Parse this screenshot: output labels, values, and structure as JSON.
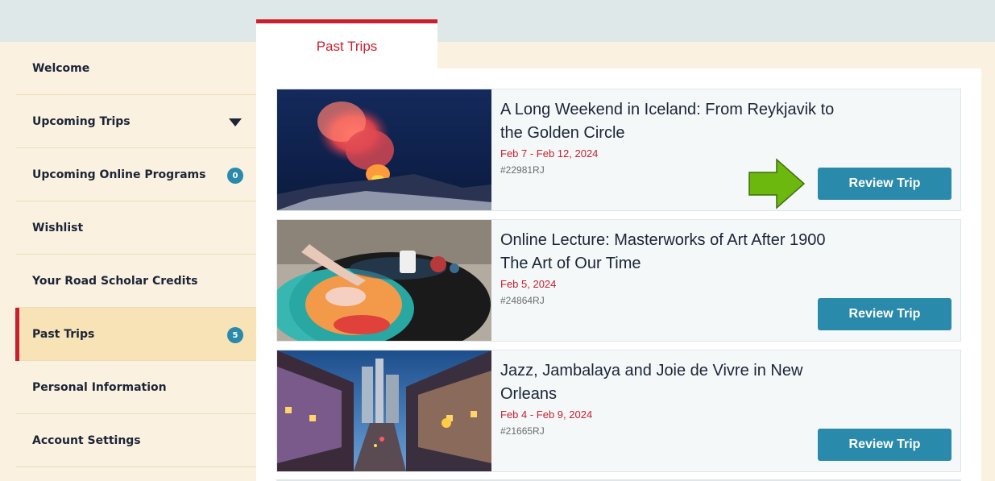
{
  "sidebar": {
    "items": [
      {
        "label": "Welcome"
      },
      {
        "label": "Upcoming Trips"
      },
      {
        "label": "Upcoming Online Programs",
        "badge": "0"
      },
      {
        "label": "Wishlist"
      },
      {
        "label": "Your Road Scholar Credits"
      },
      {
        "label": "Past Trips",
        "badge": "5"
      },
      {
        "label": "Personal Information"
      },
      {
        "label": "Account Settings"
      }
    ]
  },
  "tab": {
    "label": "Past Trips"
  },
  "trips": [
    {
      "title": "A Long Weekend in Iceland: From Reykjavik to the Golden Circle",
      "dates": "Feb 7 - Feb 12, 2024",
      "code": "#22981RJ",
      "button": "Review Trip"
    },
    {
      "title": "Online Lecture: Masterworks of Art After 1900  The Art of Our Time",
      "dates": "Feb 5, 2024",
      "code": "#24864RJ",
      "button": "Review Trip"
    },
    {
      "title": "Jazz, Jambalaya and Joie de Vivre in New Orleans",
      "dates": "Feb 4 - Feb 9, 2024",
      "code": "#21665RJ",
      "button": "Review Trip"
    }
  ],
  "colors": {
    "accent": "#c8202f",
    "button": "#2a8aab",
    "arrow": "#6cb80e"
  }
}
